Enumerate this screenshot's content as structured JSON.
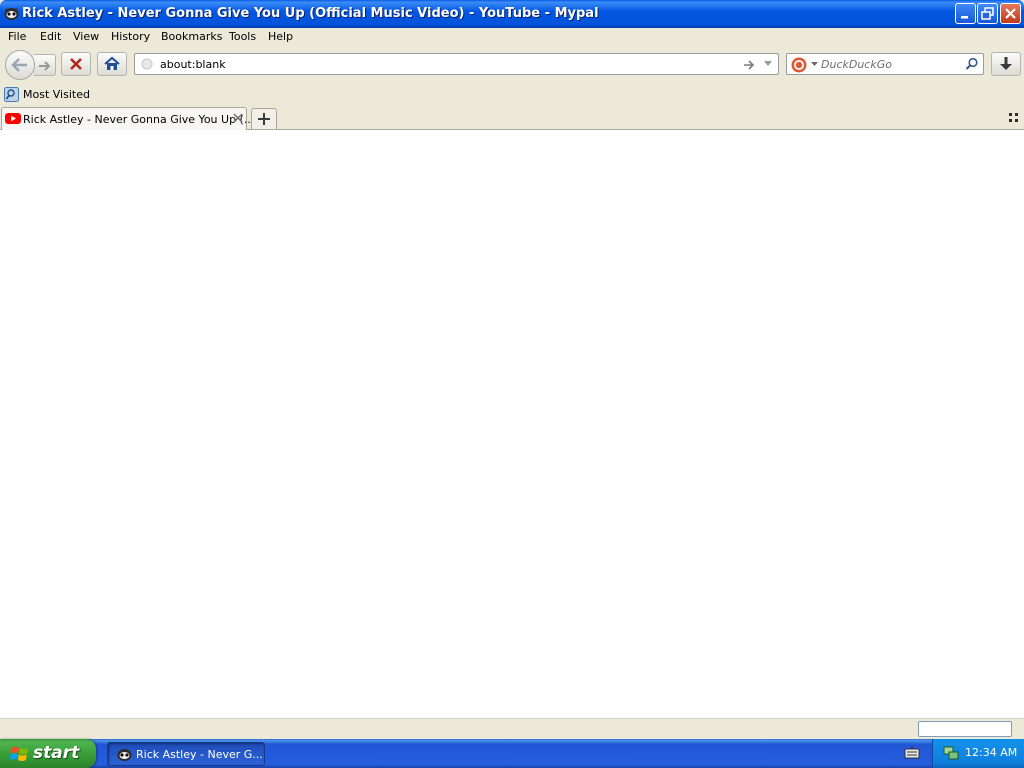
{
  "window": {
    "title": "Rick Astley - Never Gonna Give You Up (Official Music Video) - YouTube - Mypal"
  },
  "menubar": {
    "items": [
      {
        "label": "File"
      },
      {
        "label": "Edit"
      },
      {
        "label": "View"
      },
      {
        "label": "History"
      },
      {
        "label": "Bookmarks"
      },
      {
        "label": "Tools"
      },
      {
        "label": "Help"
      }
    ]
  },
  "navbar": {
    "url": "about:blank",
    "search_placeholder": "DuckDuckGo"
  },
  "bookmarks": {
    "items": [
      {
        "label": "Most Visited",
        "icon": "most-visited-icon"
      }
    ]
  },
  "tabs": [
    {
      "label": "Rick Astley - Never Gonna Give You Up (...",
      "icon": "youtube-icon"
    }
  ],
  "taskbar": {
    "start_label": "start",
    "items": [
      {
        "label": "Rick Astley - Never G..."
      }
    ],
    "clock": "12:34 AM"
  },
  "colors": {
    "titlebar": "#0558e2",
    "chrome": "#ece9d8",
    "taskbar": "#245edb",
    "start": "#3c9a3c",
    "youtube_red": "#ff0000"
  }
}
